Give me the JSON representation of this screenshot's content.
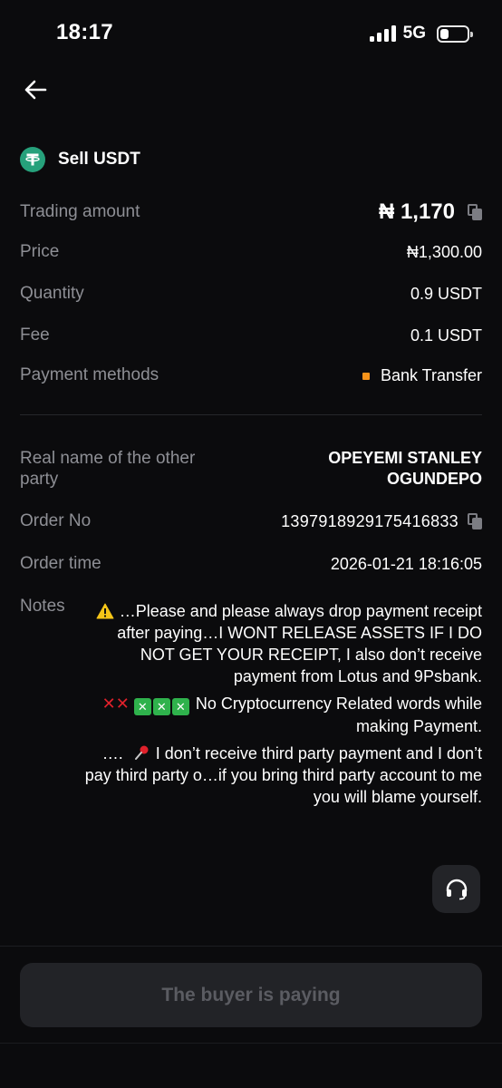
{
  "status_bar": {
    "time": "18:17",
    "network": "5G"
  },
  "header": {
    "title": "Sell USDT",
    "icon": "tether-icon"
  },
  "details": {
    "trading_amount": {
      "label": "Trading amount",
      "value": "₦ 1,170"
    },
    "price": {
      "label": "Price",
      "value": "₦1,300.00"
    },
    "quantity": {
      "label": "Quantity",
      "value": "0.9 USDT"
    },
    "fee": {
      "label": "Fee",
      "value": "0.1 USDT"
    },
    "payment_methods": {
      "label": "Payment methods",
      "value": "Bank Transfer",
      "color": "#f7931a"
    }
  },
  "order": {
    "real_name": {
      "label": "Real name of the other party",
      "value": "OPEYEMI STANLEY OGUNDEPO"
    },
    "order_no": {
      "label": "Order No",
      "value": "1397918929175416833"
    },
    "order_time": {
      "label": "Order time",
      "value": "2026-01-21 18:16:05"
    },
    "notes": {
      "label": "Notes",
      "line1": "…Please and please always drop payment receipt after paying…I WONT RELEASE ASSETS IF I DO NOT GET YOUR RECEIPT, I also don’t receive payment from Lotus and 9Psbank.",
      "line2": "No Cryptocurrency Related words while making Payment.",
      "line3_prefix": "….",
      "line3": "I don’t receive third party payment and I don’t pay third party o…if you bring third party account to me you will blame yourself."
    }
  },
  "actions": {
    "status_button": "The buyer is paying",
    "support": "headset-icon"
  },
  "colors": {
    "background": "#0b0b0d",
    "accent": "#26a17b",
    "muted_label": "#8e8f95"
  }
}
